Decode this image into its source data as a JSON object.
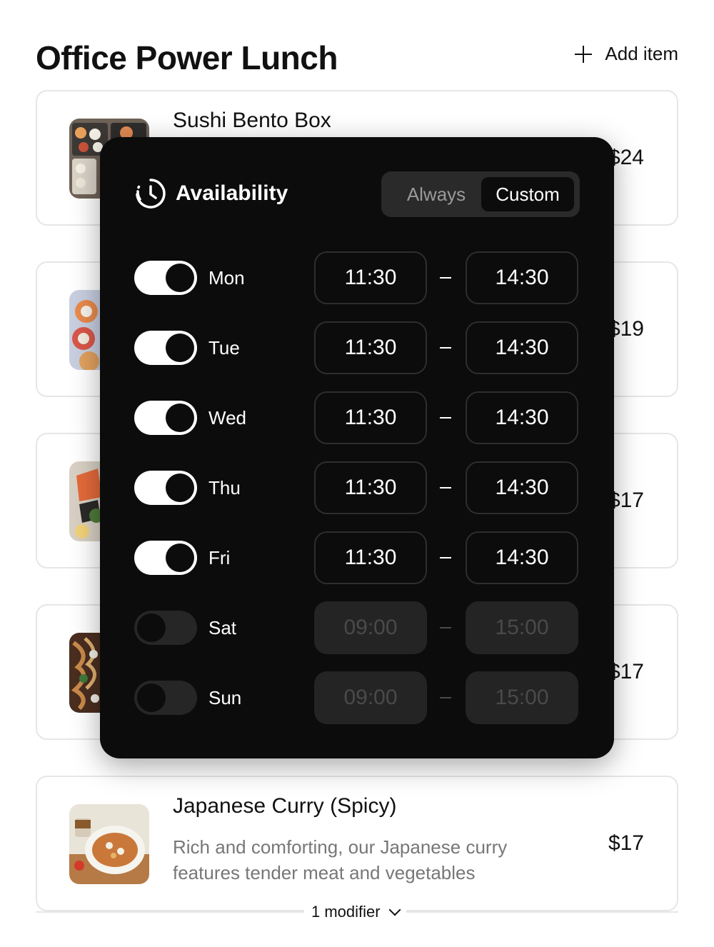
{
  "header": {
    "title": "Office Power Lunch",
    "add_item_label": "Add item"
  },
  "items": [
    {
      "name": "Sushi Bento Box",
      "desc": "",
      "price": "$24"
    },
    {
      "name": "",
      "desc": "",
      "price": "$19"
    },
    {
      "name": "",
      "desc": "",
      "price": "$17"
    },
    {
      "name": "",
      "desc": "",
      "price": "$17"
    },
    {
      "name": "Japanese Curry (Spicy)",
      "desc": "Rich and comforting, our Japanese curry features tender meat and vegetables",
      "price": "$17"
    }
  ],
  "modifier": {
    "label": "1 modifier"
  },
  "availability": {
    "title": "Availability",
    "mode_options": [
      "Always",
      "Custom"
    ],
    "selected_mode": "Custom",
    "days": [
      {
        "label": "Mon",
        "enabled": true,
        "start": "11:30",
        "end": "14:30"
      },
      {
        "label": "Tue",
        "enabled": true,
        "start": "11:30",
        "end": "14:30"
      },
      {
        "label": "Wed",
        "enabled": true,
        "start": "11:30",
        "end": "14:30"
      },
      {
        "label": "Thu",
        "enabled": true,
        "start": "11:30",
        "end": "14:30"
      },
      {
        "label": "Fri",
        "enabled": true,
        "start": "11:30",
        "end": "14:30"
      },
      {
        "label": "Sat",
        "enabled": false,
        "start": "09:00",
        "end": "15:00"
      },
      {
        "label": "Sun",
        "enabled": false,
        "start": "09:00",
        "end": "15:00"
      }
    ]
  },
  "icons": {
    "add": "plus-icon",
    "availability": "clock-icon",
    "modifier_expand": "chevron-down-icon"
  },
  "colors": {
    "popover_bg": "#0c0c0c",
    "toggle_on": "#ffffff",
    "toggle_off": "#262626",
    "muted_text": "#777777"
  }
}
